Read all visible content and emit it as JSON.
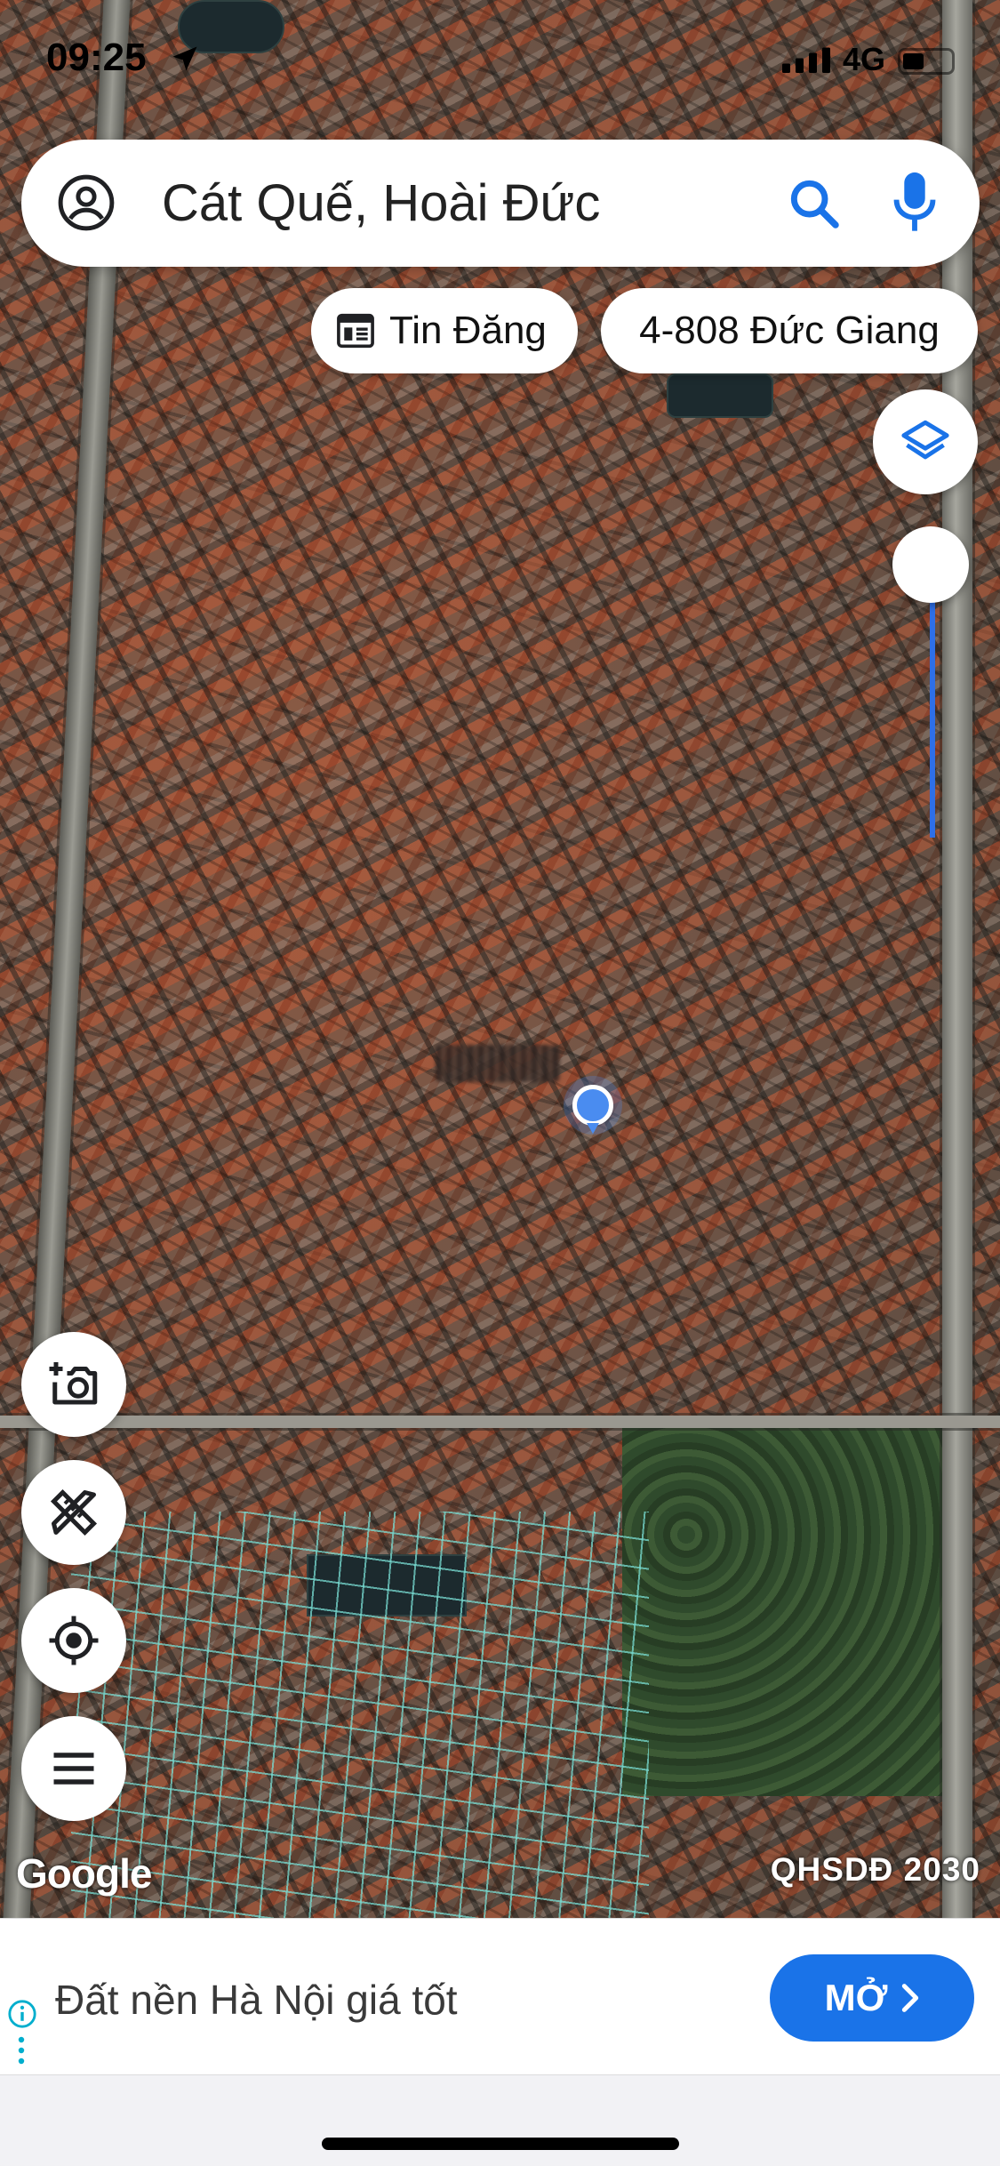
{
  "status_bar": {
    "time": "09:25",
    "network": "4G",
    "battery_level": 0.45
  },
  "search": {
    "query": "Cát Quế, Hoài Đức"
  },
  "chips": {
    "news_label": "Tin Đăng",
    "place_label": "4-808 Đức Giang"
  },
  "map": {
    "google_logo": "Google",
    "plan_label": "QHSDĐ 2030",
    "parcel_overlay_color": "#78dcd2"
  },
  "ad": {
    "text": "Đất nền Hà Nội giá tốt",
    "open_label": "MỞ"
  },
  "colors": {
    "accent": "#1a73e8",
    "location_dot": "#4a8cf0"
  }
}
